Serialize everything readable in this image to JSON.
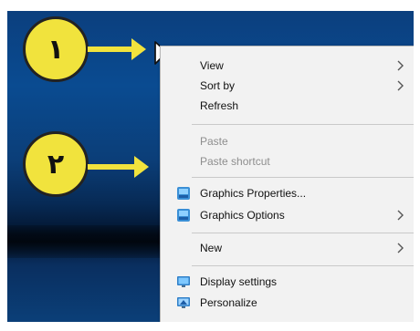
{
  "callouts": {
    "first": "١",
    "second": "٢"
  },
  "context_menu": {
    "items": [
      {
        "label": "View",
        "enabled": true,
        "submenu": true,
        "icon": ""
      },
      {
        "label": "Sort by",
        "enabled": true,
        "submenu": true,
        "icon": ""
      },
      {
        "label": "Refresh",
        "enabled": true,
        "submenu": false,
        "icon": ""
      },
      {
        "label": "Paste",
        "enabled": false,
        "submenu": false,
        "icon": ""
      },
      {
        "label": "Paste shortcut",
        "enabled": false,
        "submenu": false,
        "icon": ""
      },
      {
        "label": "Graphics Properties...",
        "enabled": true,
        "submenu": false,
        "icon": "graphics-icon"
      },
      {
        "label": "Graphics Options",
        "enabled": true,
        "submenu": true,
        "icon": "graphics-icon"
      },
      {
        "label": "New",
        "enabled": true,
        "submenu": true,
        "icon": ""
      },
      {
        "label": "Display settings",
        "enabled": true,
        "submenu": false,
        "icon": "display-icon"
      },
      {
        "label": "Personalize",
        "enabled": true,
        "submenu": false,
        "icon": "personalize-icon"
      }
    ]
  },
  "colors": {
    "callout": "#f1e33d",
    "menu_background": "#f2f2f2",
    "disabled_text": "#8e8e8e",
    "desktop_blue": "#0b3f7e"
  }
}
